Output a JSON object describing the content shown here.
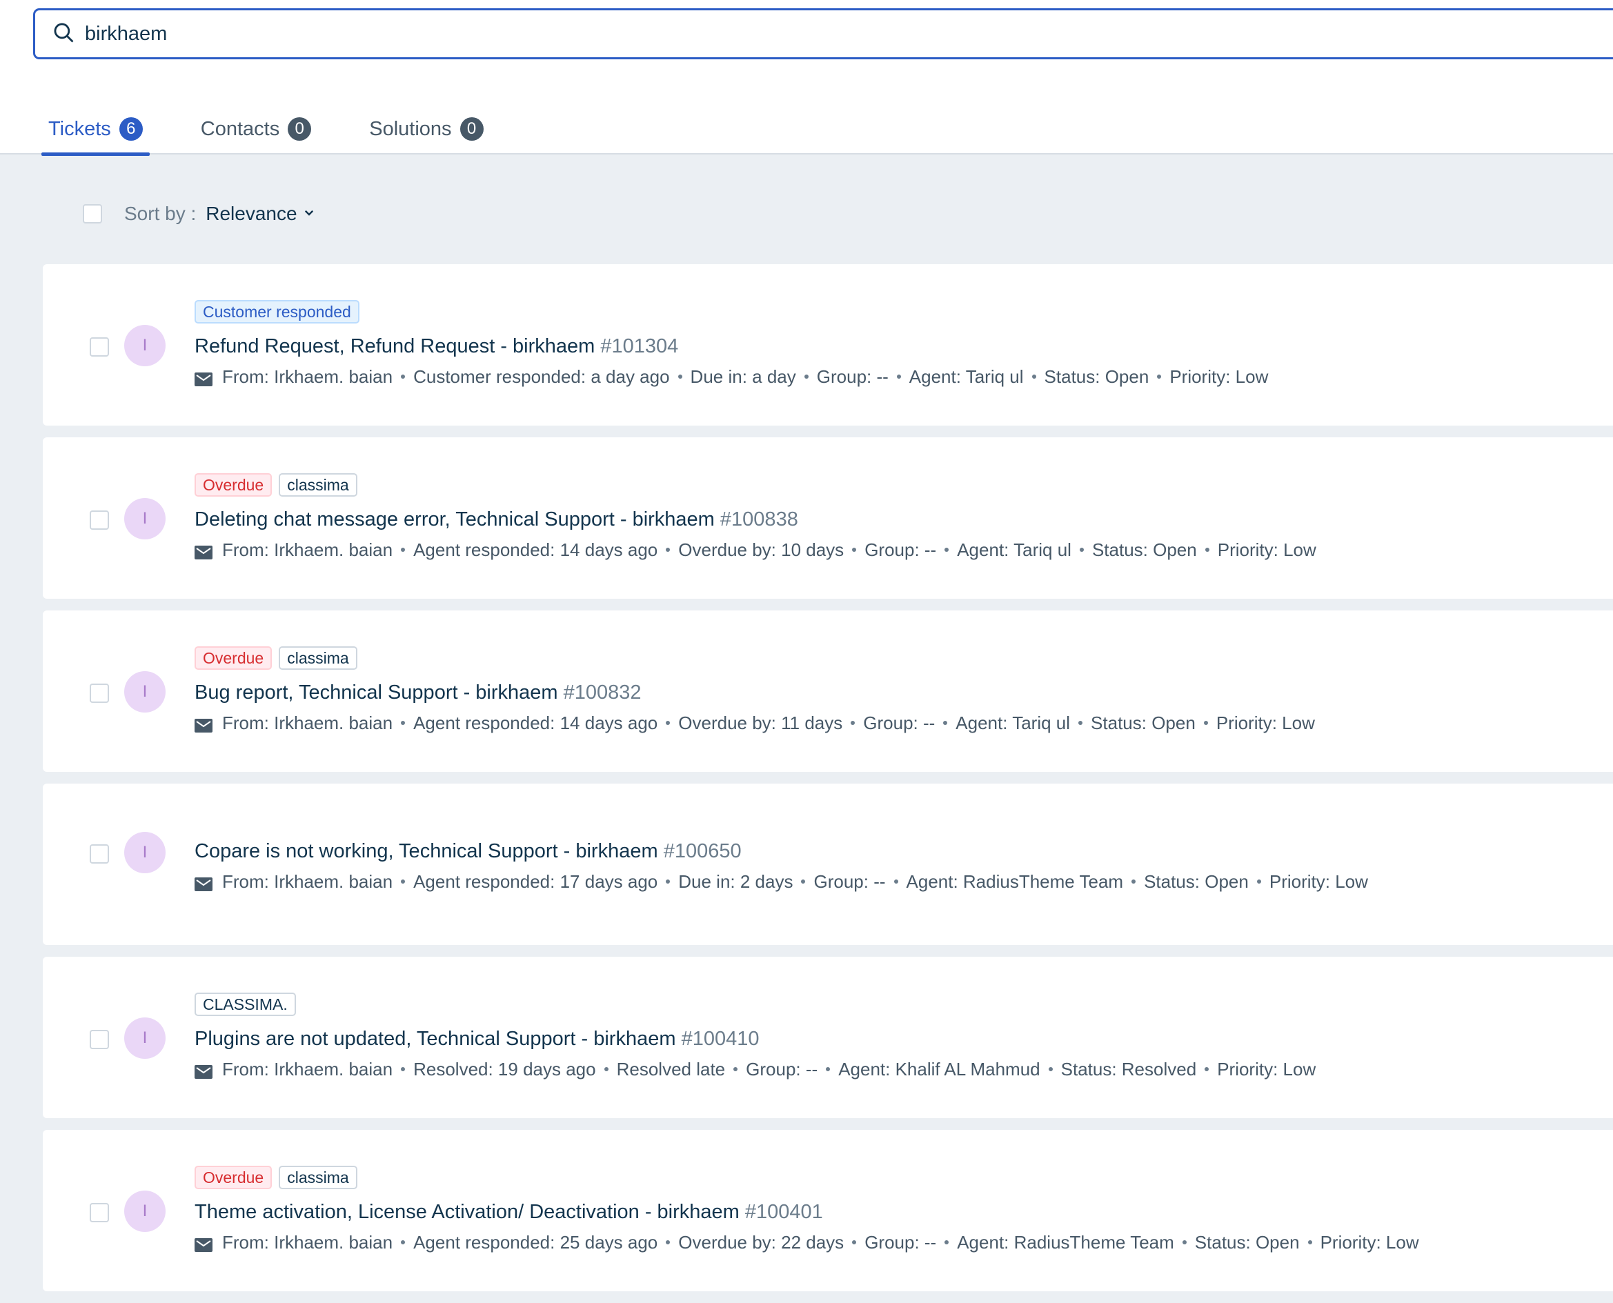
{
  "search": {
    "query": "birkhaem"
  },
  "tabs": [
    {
      "label": "Tickets",
      "count": "6"
    },
    {
      "label": "Contacts",
      "count": "0"
    },
    {
      "label": "Solutions",
      "count": "0"
    }
  ],
  "sort": {
    "label": "Sort by :",
    "value": "Relevance"
  },
  "colors": {
    "accent": "#2c5cc5",
    "overdue": "#d72d30",
    "avatar_bg": "#ead7f7"
  },
  "tickets": [
    {
      "avatar": "I",
      "tags": [
        {
          "text": "Customer responded",
          "style": "blue"
        }
      ],
      "title": "Refund Request, Refund Request - birkhaem",
      "number": "#101304",
      "meta": [
        "From:  Irkhaem. baian",
        "Customer responded: a day ago",
        "Due in: a day",
        "Group: --",
        "Agent: Tariq ul",
        "Status: Open",
        "Priority: Low"
      ]
    },
    {
      "avatar": "I",
      "tags": [
        {
          "text": "Overdue",
          "style": "red"
        },
        {
          "text": "classima",
          "style": "gray"
        }
      ],
      "title": "Deleting chat message error, Technical Support - birkhaem",
      "number": "#100838",
      "meta": [
        "From:  Irkhaem. baian",
        "Agent responded: 14 days ago",
        "Overdue by: 10 days",
        "Group: --",
        "Agent: Tariq ul",
        "Status: Open",
        "Priority: Low"
      ]
    },
    {
      "avatar": "I",
      "tags": [
        {
          "text": "Overdue",
          "style": "red"
        },
        {
          "text": "classima",
          "style": "gray"
        }
      ],
      "title": "Bug report, Technical Support - birkhaem",
      "number": "#100832",
      "meta": [
        "From:  Irkhaem. baian",
        "Agent responded: 14 days ago",
        "Overdue by: 11 days",
        "Group: --",
        "Agent: Tariq ul",
        "Status: Open",
        "Priority: Low"
      ]
    },
    {
      "avatar": "I",
      "tags": [],
      "title": "Copare is not working, Technical Support - birkhaem",
      "number": "#100650",
      "meta": [
        "From:  Irkhaem. baian",
        "Agent responded: 17 days ago",
        "Due in: 2 days",
        "Group: --",
        "Agent: RadiusTheme Team",
        "Status: Open",
        "Priority: Low"
      ]
    },
    {
      "avatar": "I",
      "tags": [
        {
          "text": "CLASSIMA.",
          "style": "gray"
        }
      ],
      "title": "Plugins are not updated, Technical Support - birkhaem",
      "number": "#100410",
      "meta": [
        "From:  Irkhaem. baian",
        "Resolved: 19 days ago",
        "Resolved late",
        "Group: --",
        "Agent: Khalif AL Mahmud",
        "Status: Resolved",
        "Priority: Low"
      ]
    },
    {
      "avatar": "I",
      "tags": [
        {
          "text": "Overdue",
          "style": "red"
        },
        {
          "text": "classima",
          "style": "gray"
        }
      ],
      "title": "Theme activation, License Activation/ Deactivation - birkhaem",
      "number": "#100401",
      "meta": [
        "From:  Irkhaem. baian",
        "Agent responded: 25 days ago",
        "Overdue by: 22 days",
        "Group: --",
        "Agent: RadiusTheme Team",
        "Status: Open",
        "Priority: Low"
      ]
    }
  ]
}
